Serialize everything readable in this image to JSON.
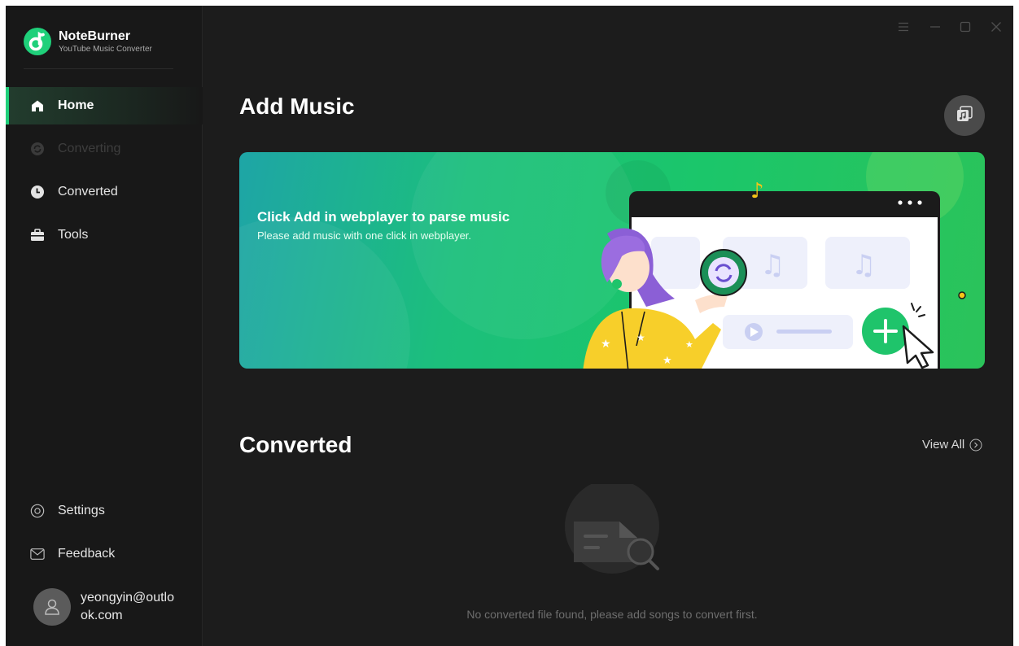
{
  "app": {
    "brand_title": "NoteBurner",
    "brand_subtitle": "YouTube Music Converter",
    "accent_color": "#1fd07a"
  },
  "window_controls": [
    "menu-icon",
    "minimize-icon",
    "maximize-icon",
    "close-icon"
  ],
  "sidebar": {
    "items": [
      {
        "label": "Home",
        "icon": "home-icon",
        "state": "active"
      },
      {
        "label": "Converting",
        "icon": "converting-icon",
        "state": "disabled"
      },
      {
        "label": "Converted",
        "icon": "clock-icon",
        "state": "normal"
      },
      {
        "label": "Tools",
        "icon": "toolbox-icon",
        "state": "normal"
      }
    ],
    "bottom_items": [
      {
        "label": "Settings",
        "icon": "gear-icon"
      },
      {
        "label": "Feedback",
        "icon": "mail-icon"
      }
    ],
    "user": {
      "email": "yeongyin@outlook.com",
      "icon": "user-icon"
    }
  },
  "main": {
    "add_music": {
      "heading": "Add Music",
      "banner_title": "Click Add in webplayer to parse music",
      "banner_subtitle": "Please add music with one click in webplayer.",
      "side_button_icon": "music-library-icon"
    },
    "converted": {
      "heading": "Converted",
      "view_all": "View All",
      "empty_text": "No converted file found, please add songs to convert first."
    }
  }
}
